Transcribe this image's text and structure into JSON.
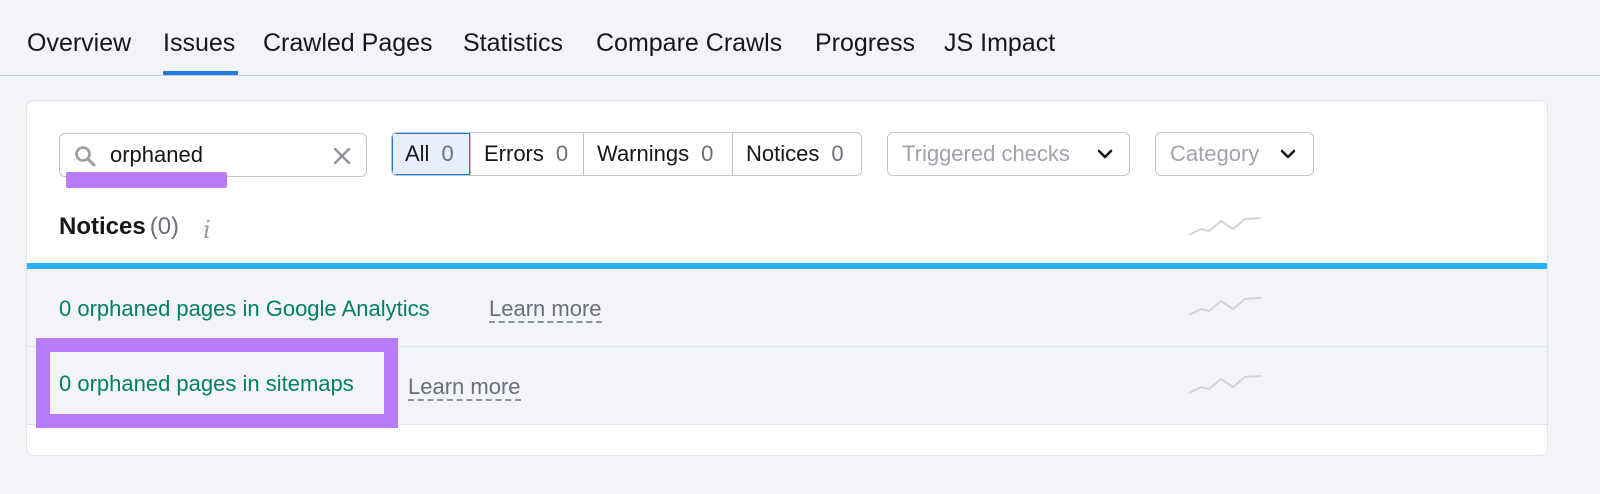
{
  "tabs": [
    {
      "label": "Overview"
    },
    {
      "label": "Issues",
      "active": true
    },
    {
      "label": "Crawled Pages"
    },
    {
      "label": "Statistics"
    },
    {
      "label": "Compare Crawls"
    },
    {
      "label": "Progress"
    },
    {
      "label": "JS Impact"
    }
  ],
  "search": {
    "value": "orphaned",
    "icon": "search-icon",
    "clear_icon": "close-icon"
  },
  "filters": [
    {
      "label": "All",
      "count": "0",
      "active": true
    },
    {
      "label": "Errors",
      "count": "0"
    },
    {
      "label": "Warnings",
      "count": "0"
    },
    {
      "label": "Notices",
      "count": "0"
    }
  ],
  "dropdowns": {
    "triggered_checks": "Triggered checks",
    "category": "Category"
  },
  "notices": {
    "title": "Notices",
    "count": "(0)",
    "info_icon": "i"
  },
  "issues": [
    {
      "title": "0 orphaned pages in Google Analytics",
      "learn_more": "Learn more"
    },
    {
      "title": "0 orphaned pages in sitemaps",
      "learn_more": "Learn more"
    }
  ],
  "colors": {
    "accent": "#1f7ae0",
    "highlight": "#b97cf6",
    "link_green": "#008162",
    "progress_bar": "#2bb1f3"
  }
}
